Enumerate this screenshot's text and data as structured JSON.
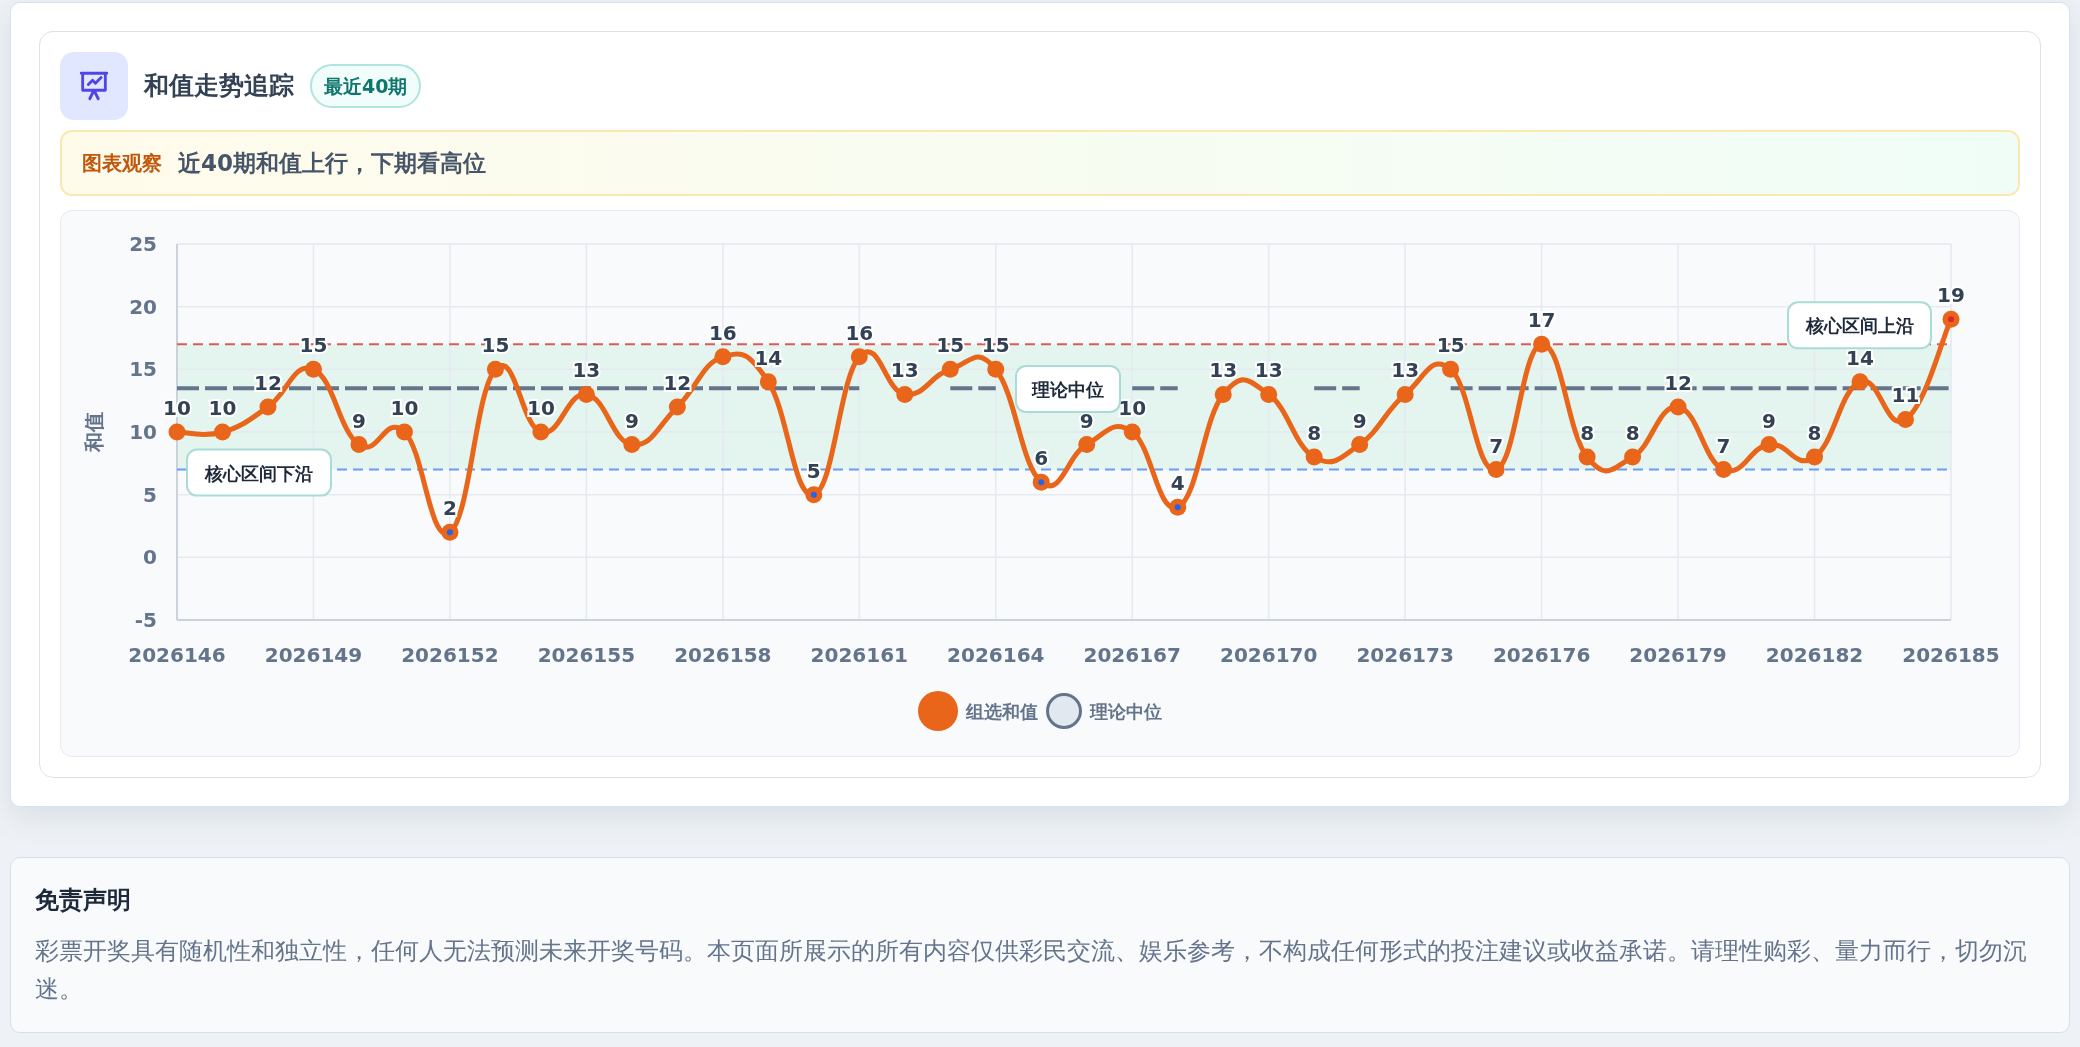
{
  "header": {
    "title": "和值走势追踪",
    "badge": "最近40期"
  },
  "insight": {
    "label": "图表观察",
    "text": "近40期和值上行，下期看高位"
  },
  "chart": {
    "chart_data": {
      "type": "line",
      "ylabel": "和值",
      "x": [
        2026146,
        2026147,
        2026148,
        2026149,
        2026150,
        2026151,
        2026152,
        2026153,
        2026154,
        2026155,
        2026156,
        2026157,
        2026158,
        2026159,
        2026160,
        2026161,
        2026162,
        2026163,
        2026164,
        2026165,
        2026166,
        2026167,
        2026168,
        2026169,
        2026170,
        2026171,
        2026172,
        2026173,
        2026174,
        2026175,
        2026176,
        2026177,
        2026178,
        2026179,
        2026180,
        2026181,
        2026182,
        2026183,
        2026184,
        2026185
      ],
      "series": [
        {
          "name": "组选和值",
          "color": "#e8651a",
          "marker": "circle",
          "values": [
            10,
            10,
            12,
            15,
            9,
            10,
            2,
            15,
            10,
            13,
            9,
            12,
            16,
            14,
            5,
            16,
            13,
            15,
            15,
            6,
            9,
            10,
            4,
            13,
            13,
            8,
            9,
            13,
            15,
            7,
            17,
            8,
            8,
            12,
            7,
            9,
            8,
            14,
            11,
            19
          ]
        },
        {
          "name": "理论中位",
          "color": "#64748b",
          "line_style": "dashed",
          "values": [
            13.5,
            13.5,
            13.5,
            13.5,
            13.5,
            13.5,
            13.5,
            13.5,
            13.5,
            13.5,
            13.5,
            13.5,
            13.5,
            13.5,
            13.5,
            13.5,
            null,
            13.5,
            13.5,
            null,
            null,
            13.5,
            13.5,
            null,
            null,
            13.5,
            13.5,
            null,
            13.5,
            13.5,
            13.5,
            13.5,
            13.5,
            13.5,
            13.5,
            13.5,
            13.5,
            13.5,
            13.5,
            13.5
          ]
        }
      ],
      "xlim": [
        2026146,
        2026185
      ],
      "ylim": [
        -5,
        25
      ],
      "yticks": [
        -5,
        0,
        5,
        10,
        15,
        20,
        25
      ],
      "xticks": [
        2026146,
        2026149,
        2026152,
        2026155,
        2026158,
        2026161,
        2026164,
        2026167,
        2026170,
        2026173,
        2026176,
        2026179,
        2026182,
        2026185
      ],
      "grid": true,
      "legend": "bottom",
      "value_labels": [
        [
          "10",
          "10",
          "12",
          "15",
          "9",
          "10",
          "2",
          "15",
          "10",
          "13",
          "9",
          "12",
          "16",
          "14",
          "5",
          "16",
          "13",
          "15",
          "15",
          "6",
          "9",
          "10",
          "4",
          "13",
          "13",
          "8",
          "9",
          "13",
          "15",
          "7",
          "17",
          "8",
          "8",
          "12",
          "7",
          "9",
          "8",
          "14",
          "11",
          "19"
        ],
        [
          null,
          null,
          null,
          null,
          null,
          null,
          null,
          null,
          null,
          null,
          null,
          null,
          null,
          null,
          null,
          null,
          null,
          null,
          null,
          null,
          null,
          null,
          null,
          null,
          null,
          null,
          null,
          null,
          null,
          null,
          null,
          null,
          null,
          null,
          null,
          null,
          null,
          null,
          null,
          null
        ]
      ],
      "ref_lines": [
        {
          "axis": "y",
          "value": 7,
          "label": "核心区间下沿",
          "color": "#6b9bf5",
          "line_style": "dashed"
        },
        {
          "axis": "y",
          "value": 17,
          "label": "核心区间上沿",
          "color": "#e05a5a",
          "line_style": "dashed"
        }
      ],
      "bands": [
        {
          "axis": "y",
          "from": 7,
          "to": 17,
          "color": "#e4f4ef"
        }
      ],
      "annotations": [
        "理论中位"
      ]
    }
  },
  "disclaimer": {
    "title": "免责声明",
    "text": "彩票开奖具有随机性和独立性，任何人无法预测未来开奖号码。本页面所展示的所有内容仅供彩民交流、娱乐参考，不构成任何形式的投注建议或收益承诺。请理性购彩、量力而行，切勿沉迷。"
  }
}
